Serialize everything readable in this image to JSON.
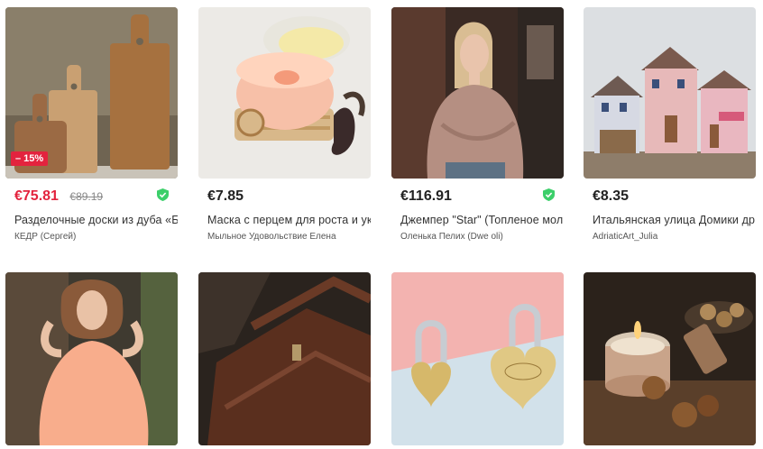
{
  "products": [
    {
      "price": "€75.81",
      "old_price": "€89.19",
      "discount": "– 15%",
      "title": "Разделочные доски из дуба «Б…",
      "shop": "КЕДР (Сергей)",
      "verified": true,
      "image": "oak-cutting-boards"
    },
    {
      "price": "€7.85",
      "title": "Маска с перцем для роста и ук…",
      "shop": "Мыльное Удовольствие Елена",
      "verified": false,
      "image": "pepper-hair-mask"
    },
    {
      "price": "€116.91",
      "title": "Джемпер \"Star\" (Топленое мол…",
      "shop": "Оленька Пелих (Dwe oli)",
      "verified": true,
      "image": "knit-jumper"
    },
    {
      "price": "€8.35",
      "title": "Итальянская улица Домики др…",
      "shop": "AdriaticArt_Julia",
      "verified": false,
      "image": "wooden-houses"
    },
    {
      "image": "peach-dress"
    },
    {
      "image": "leather-bag"
    },
    {
      "image": "love-padlocks"
    },
    {
      "image": "candle-nuts"
    }
  ],
  "colors": {
    "sale": "#e3233e",
    "verified": "#3ccf6a"
  }
}
